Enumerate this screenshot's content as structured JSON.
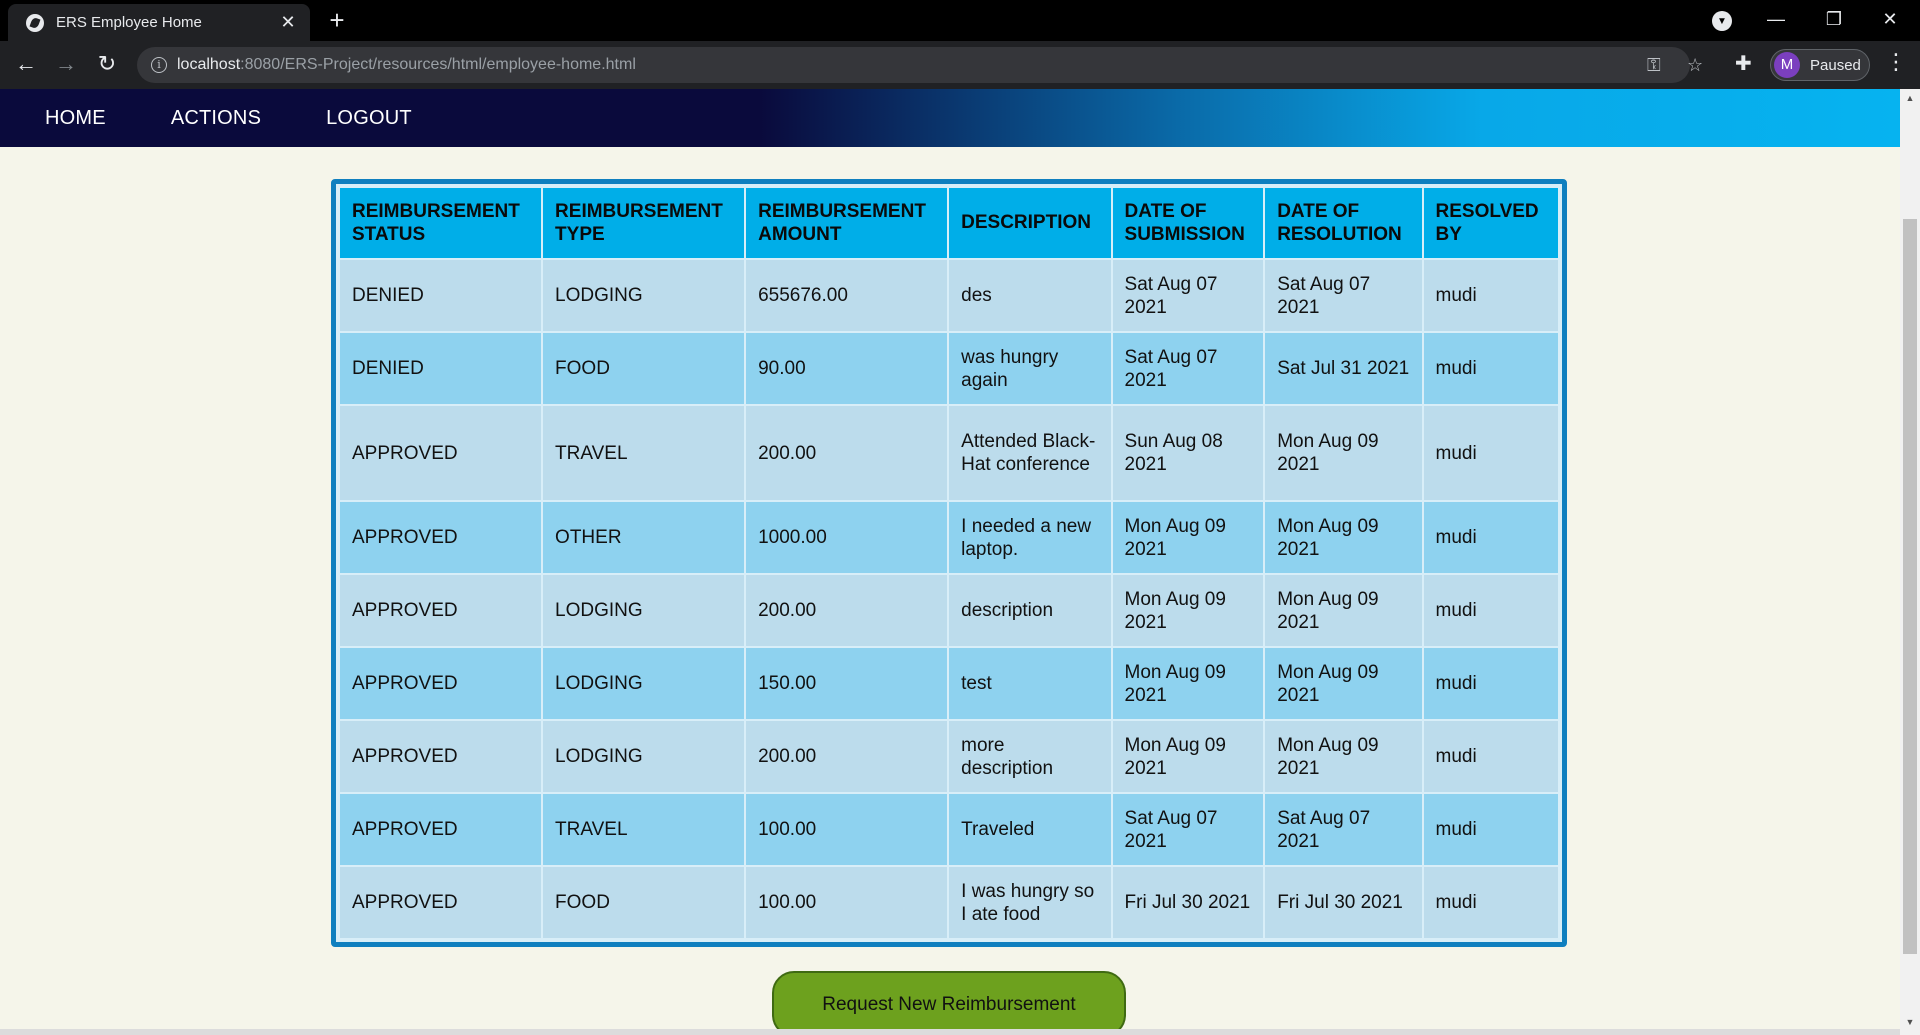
{
  "browser": {
    "tab_title": "ERS Employee Home",
    "url_host": "localhost",
    "url_rest": ":8080/ERS-Project/resources/html/employee-home.html",
    "profile_initial": "M",
    "profile_status": "Paused"
  },
  "navbar": {
    "items": [
      "HOME",
      "ACTIONS",
      "LOGOUT"
    ]
  },
  "table": {
    "headers": [
      "REIMBURSEMENT STATUS",
      "REIMBURSEMENT TYPE",
      "REIMBURSEMENT AMOUNT",
      "DESCRIPTION",
      "DATE OF SUBMISSION",
      "DATE OF RESOLUTION",
      "RESOLVED BY"
    ],
    "rows": [
      [
        "DENIED",
        "LODGING",
        "655676.00",
        "des",
        "Sat Aug 07 2021",
        "Sat Aug 07 2021",
        "mudi"
      ],
      [
        "DENIED",
        "FOOD",
        "90.00",
        "was hungry again",
        "Sat Aug 07 2021",
        "Sat Jul 31 2021",
        "mudi"
      ],
      [
        "APPROVED",
        "TRAVEL",
        "200.00",
        "Attended Black-Hat conference",
        "Sun Aug 08 2021",
        "Mon Aug 09 2021",
        "mudi"
      ],
      [
        "APPROVED",
        "OTHER",
        "1000.00",
        "I needed a new laptop.",
        "Mon Aug 09 2021",
        "Mon Aug 09 2021",
        "mudi"
      ],
      [
        "APPROVED",
        "LODGING",
        "200.00",
        "description",
        "Mon Aug 09 2021",
        "Mon Aug 09 2021",
        "mudi"
      ],
      [
        "APPROVED",
        "LODGING",
        "150.00",
        "test",
        "Mon Aug 09 2021",
        "Mon Aug 09 2021",
        "mudi"
      ],
      [
        "APPROVED",
        "LODGING",
        "200.00",
        "more description",
        "Mon Aug 09 2021",
        "Mon Aug 09 2021",
        "mudi"
      ],
      [
        "APPROVED",
        "TRAVEL",
        "100.00",
        "Traveled",
        "Sat Aug 07 2021",
        "Sat Aug 07 2021",
        "mudi"
      ],
      [
        "APPROVED",
        "FOOD",
        "100.00",
        "I was hungry so I ate food",
        "Fri Jul 30 2021",
        "Fri Jul 30 2021",
        "mudi"
      ]
    ]
  },
  "request_button_label": "Request New Reimbursement"
}
